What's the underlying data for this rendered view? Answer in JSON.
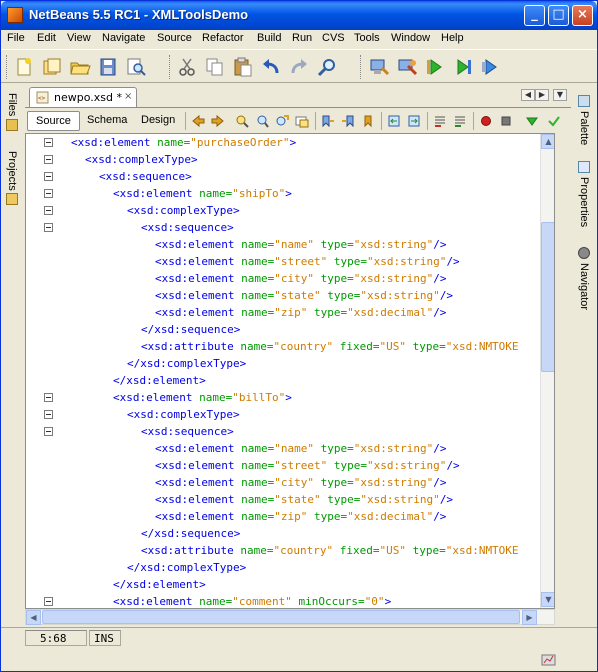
{
  "window": {
    "title": "NetBeans 5.5 RC1 - XMLToolsDemo"
  },
  "titlebar_buttons": {
    "minimize": "_",
    "maximize": "□",
    "close": "×"
  },
  "menu": [
    "File",
    "Edit",
    "View",
    "Navigate",
    "Source",
    "Refactor",
    "Build",
    "Run",
    "CVS",
    "Tools",
    "Window",
    "Help"
  ],
  "toolbar": {
    "icons": [
      "new-file-icon",
      "new-project-icon",
      "open-project-icon",
      "save-all-icon",
      "search-file-icon",
      "cut-icon",
      "copy-icon",
      "paste-icon",
      "undo-icon",
      "redo-icon",
      "find-icon",
      "build-icon",
      "clean-build-icon",
      "run-icon",
      "debug-icon",
      "profile-icon"
    ]
  },
  "left_panel": {
    "tabs": [
      "Files",
      "Projects"
    ]
  },
  "right_panel": {
    "tabs": [
      "Palette",
      "Properties",
      "Navigator"
    ]
  },
  "editor": {
    "tab_label": "newpo.xsd *",
    "tab_close": "×",
    "views": [
      "Source",
      "Schema",
      "Design"
    ],
    "active_view": "Source",
    "lines": [
      [
        [
          "tag",
          "<xsd:element "
        ],
        [
          "attr",
          "name="
        ],
        [
          "val",
          "\"purchaseOrder\""
        ],
        [
          "tag",
          ">"
        ]
      ],
      [
        [
          "tag",
          "<xsd:complexType>"
        ]
      ],
      [
        [
          "tag",
          "<xsd:sequence>"
        ]
      ],
      [
        [
          "tag",
          "<xsd:element "
        ],
        [
          "attr",
          "name="
        ],
        [
          "val",
          "\"shipTo\""
        ],
        [
          "tag",
          ">"
        ]
      ],
      [
        [
          "tag",
          "<xsd:complexType>"
        ]
      ],
      [
        [
          "tag",
          "<xsd:sequence>"
        ]
      ],
      [
        [
          "tag",
          "<xsd:element "
        ],
        [
          "attr",
          "name="
        ],
        [
          "val",
          "\"name\""
        ],
        [
          "plain",
          " "
        ],
        [
          "attr",
          "type="
        ],
        [
          "val",
          "\"xsd:string\""
        ],
        [
          "tag",
          "/>"
        ]
      ],
      [
        [
          "tag",
          "<xsd:element "
        ],
        [
          "attr",
          "name="
        ],
        [
          "val",
          "\"street\""
        ],
        [
          "plain",
          " "
        ],
        [
          "attr",
          "type="
        ],
        [
          "val",
          "\"xsd:string\""
        ],
        [
          "tag",
          "/>"
        ]
      ],
      [
        [
          "tag",
          "<xsd:element "
        ],
        [
          "attr",
          "name="
        ],
        [
          "val",
          "\"city\""
        ],
        [
          "plain",
          " "
        ],
        [
          "attr",
          "type="
        ],
        [
          "val",
          "\"xsd:string\""
        ],
        [
          "tag",
          "/>"
        ]
      ],
      [
        [
          "tag",
          "<xsd:element "
        ],
        [
          "attr",
          "name="
        ],
        [
          "val",
          "\"state\""
        ],
        [
          "plain",
          " "
        ],
        [
          "attr",
          "type="
        ],
        [
          "val",
          "\"xsd:string\""
        ],
        [
          "tag",
          "/>"
        ]
      ],
      [
        [
          "tag",
          "<xsd:element "
        ],
        [
          "attr",
          "name="
        ],
        [
          "val",
          "\"zip\""
        ],
        [
          "plain",
          " "
        ],
        [
          "attr",
          "type="
        ],
        [
          "val",
          "\"xsd:decimal\""
        ],
        [
          "tag",
          "/>"
        ]
      ],
      [
        [
          "tag",
          "</xsd:sequence>"
        ]
      ],
      [
        [
          "tag",
          "<xsd:attribute "
        ],
        [
          "attr",
          "name="
        ],
        [
          "val",
          "\"country\""
        ],
        [
          "plain",
          " "
        ],
        [
          "attr",
          "fixed="
        ],
        [
          "val",
          "\"US\""
        ],
        [
          "plain",
          " "
        ],
        [
          "attr",
          "type="
        ],
        [
          "val",
          "\"xsd:NMTOKE"
        ]
      ],
      [
        [
          "tag",
          "</xsd:complexType>"
        ]
      ],
      [
        [
          "tag",
          "</xsd:element>"
        ]
      ],
      [
        [
          "tag",
          "<xsd:element "
        ],
        [
          "attr",
          "name="
        ],
        [
          "val",
          "\"billTo\""
        ],
        [
          "tag",
          ">"
        ]
      ],
      [
        [
          "tag",
          "<xsd:complexType>"
        ]
      ],
      [
        [
          "tag",
          "<xsd:sequence>"
        ]
      ],
      [
        [
          "tag",
          "<xsd:element "
        ],
        [
          "attr",
          "name="
        ],
        [
          "val",
          "\"name\""
        ],
        [
          "plain",
          " "
        ],
        [
          "attr",
          "type="
        ],
        [
          "val",
          "\"xsd:string\""
        ],
        [
          "tag",
          "/>"
        ]
      ],
      [
        [
          "tag",
          "<xsd:element "
        ],
        [
          "attr",
          "name="
        ],
        [
          "val",
          "\"street\""
        ],
        [
          "plain",
          " "
        ],
        [
          "attr",
          "type="
        ],
        [
          "val",
          "\"xsd:string\""
        ],
        [
          "tag",
          "/>"
        ]
      ],
      [
        [
          "tag",
          "<xsd:element "
        ],
        [
          "attr",
          "name="
        ],
        [
          "val",
          "\"city\""
        ],
        [
          "plain",
          " "
        ],
        [
          "attr",
          "type="
        ],
        [
          "val",
          "\"xsd:string\""
        ],
        [
          "tag",
          "/>"
        ]
      ],
      [
        [
          "tag",
          "<xsd:element "
        ],
        [
          "attr",
          "name="
        ],
        [
          "val",
          "\"state\""
        ],
        [
          "plain",
          " "
        ],
        [
          "attr",
          "type="
        ],
        [
          "val",
          "\"xsd:string\""
        ],
        [
          "tag",
          "/>"
        ]
      ],
      [
        [
          "tag",
          "<xsd:element "
        ],
        [
          "attr",
          "name="
        ],
        [
          "val",
          "\"zip\""
        ],
        [
          "plain",
          " "
        ],
        [
          "attr",
          "type="
        ],
        [
          "val",
          "\"xsd:decimal\""
        ],
        [
          "tag",
          "/>"
        ]
      ],
      [
        [
          "tag",
          "</xsd:sequence>"
        ]
      ],
      [
        [
          "tag",
          "<xsd:attribute "
        ],
        [
          "attr",
          "name="
        ],
        [
          "val",
          "\"country\""
        ],
        [
          "plain",
          " "
        ],
        [
          "attr",
          "fixed="
        ],
        [
          "val",
          "\"US\""
        ],
        [
          "plain",
          " "
        ],
        [
          "attr",
          "type="
        ],
        [
          "val",
          "\"xsd:NMTOKE"
        ]
      ],
      [
        [
          "tag",
          "</xsd:complexType>"
        ]
      ],
      [
        [
          "tag",
          "</xsd:element>"
        ]
      ],
      [
        [
          "tag",
          "<xsd:element "
        ],
        [
          "attr",
          "name="
        ],
        [
          "val",
          "\"comment\""
        ],
        [
          "plain",
          " "
        ],
        [
          "attr",
          "minOccurs="
        ],
        [
          "val",
          "\"0\""
        ],
        [
          "tag",
          ">"
        ]
      ]
    ],
    "indent": [
      0,
      1,
      2,
      3,
      4,
      5,
      6,
      6,
      6,
      6,
      6,
      5,
      5,
      4,
      3,
      3,
      4,
      5,
      6,
      6,
      6,
      6,
      6,
      5,
      5,
      4,
      3,
      3
    ],
    "foldable": [
      true,
      true,
      true,
      true,
      true,
      true,
      false,
      false,
      false,
      false,
      false,
      false,
      false,
      false,
      false,
      true,
      true,
      true,
      false,
      false,
      false,
      false,
      false,
      false,
      false,
      false,
      false,
      true
    ]
  },
  "status": {
    "position": "5:68",
    "mode": "INS"
  },
  "colors": {
    "tag": "#0000e6",
    "attribute": "#009900",
    "value": "#ce7b00",
    "titlebar": "#0055e5"
  }
}
